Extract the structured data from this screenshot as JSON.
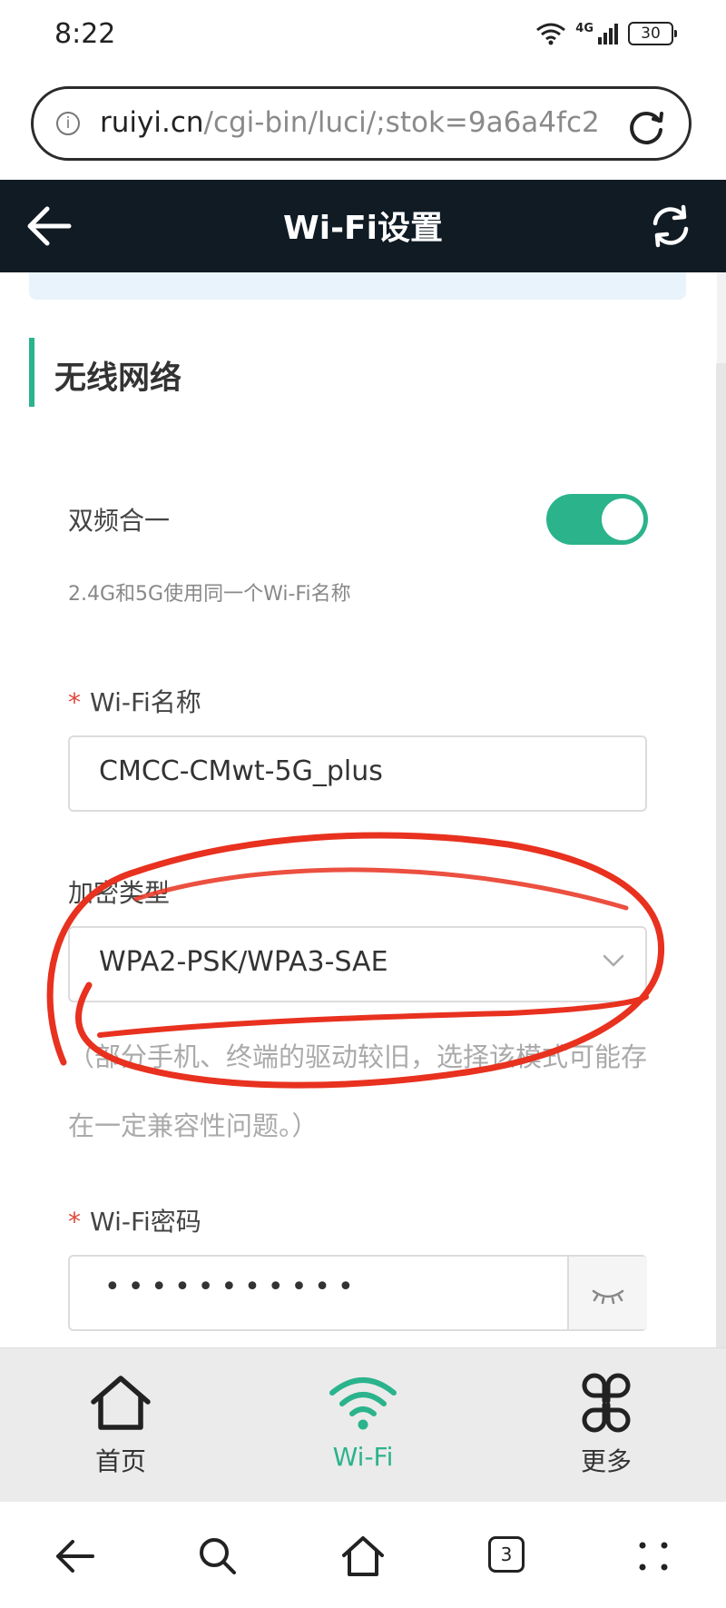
{
  "status_bar": {
    "time": "8:22",
    "network": "4G",
    "battery": "30"
  },
  "address_bar": {
    "host": "ruiyi.cn",
    "path": "/cgi-bin/luci/;stok=9a6a4fc2"
  },
  "header": {
    "title": "Wi-Fi设置"
  },
  "section": {
    "title": "无线网络"
  },
  "dual_band": {
    "label": "双频合一",
    "enabled": true,
    "description": "2.4G和5G使用同一个Wi-Fi名称"
  },
  "ssid": {
    "required_mark": "*",
    "label": "Wi-Fi名称",
    "value": "CMCC-CMwt-5G_plus"
  },
  "encryption": {
    "label": "加密类型",
    "value": "WPA2-PSK/WPA3-SAE",
    "note": "（部分手机、终端的驱动较旧，选择该模式可能存在一定兼容性问题。）"
  },
  "password": {
    "required_mark": "*",
    "label": "Wi-Fi密码",
    "masked_value": "•••••••••••"
  },
  "app_nav": {
    "home": "首页",
    "wifi": "Wi-Fi",
    "more": "更多"
  },
  "browser_bar": {
    "tab_count": "3"
  },
  "colors": {
    "accent": "#2bb38c",
    "header_bg": "#101b24",
    "annotation": "#e8311f"
  }
}
